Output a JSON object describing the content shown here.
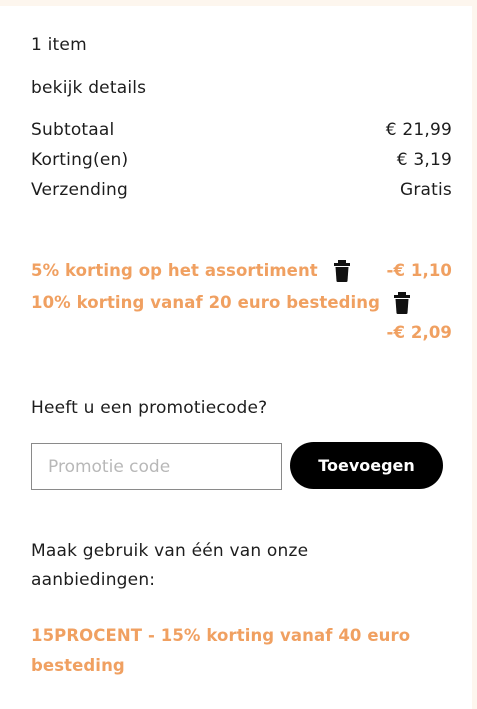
{
  "summary": {
    "item_count": "1 item",
    "details_link": "bekijk details",
    "subtotal_label": "Subtotaal",
    "subtotal_value": "€ 21,99",
    "discount_label": "Korting(en)",
    "discount_value": "€ 3,19",
    "shipping_label": "Verzending",
    "shipping_value": "Gratis"
  },
  "discounts": [
    {
      "label": "5% korting op het assortiment",
      "amount": "-€ 1,10",
      "icon": "trash-icon"
    },
    {
      "label": "10% korting vanaf 20 euro besteding",
      "amount": "-€ 2,09",
      "icon": "trash-icon"
    }
  ],
  "promo": {
    "question": "Heeft u een promotiecode?",
    "placeholder": "Promotie code",
    "button_label": "Toevoegen"
  },
  "offers": {
    "intro_line1": "Maak gebruik van één van onze",
    "intro_line2": "aanbiedingen:",
    "offer_line1": "15PROCENT - 15% korting vanaf 40 euro",
    "offer_line2": "besteding"
  },
  "colors": {
    "page_background": "#fdf6ee",
    "card_background": "#ffffff",
    "promo_accent": "#f0a061",
    "button_background": "#000000",
    "button_text": "#ffffff"
  }
}
